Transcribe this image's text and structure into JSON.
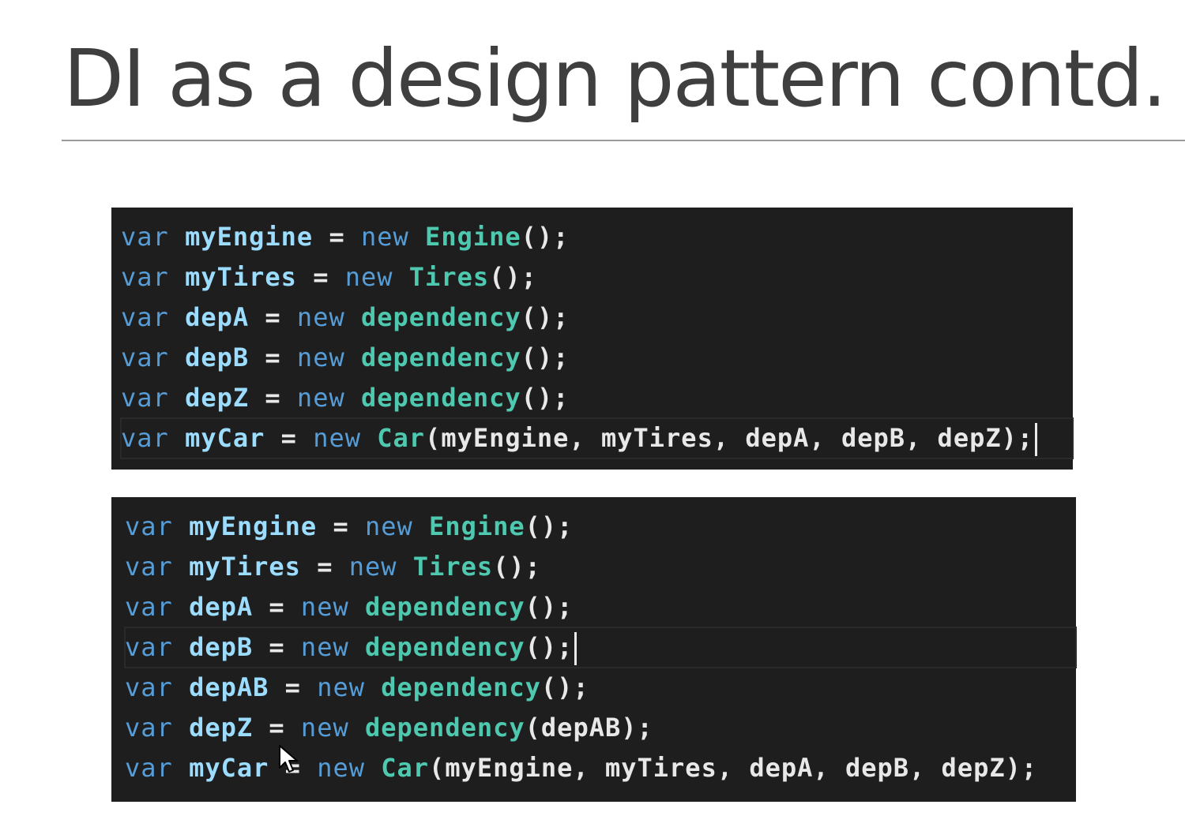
{
  "slide": {
    "title": "DI as a design pattern contd."
  },
  "colors": {
    "editor_background": "#1e1e1e",
    "keyword": "#569cd6",
    "identifier": "#9cdcfe",
    "type_name": "#4ec9b0",
    "punctuation": "#e8e8e8",
    "title_text": "#3f3f3f"
  },
  "code_blocks": [
    {
      "lines": [
        {
          "kw": "var",
          "id": "myEngine",
          "eq": " = ",
          "new": "new",
          "type": "Engine",
          "rest": "();"
        },
        {
          "kw": "var",
          "id": "myTires",
          "eq": " = ",
          "new": "new",
          "type": "Tires",
          "rest": "();"
        },
        {
          "kw": "var",
          "id": "depA",
          "eq": " = ",
          "new": "new",
          "type": "dependency",
          "rest": "();"
        },
        {
          "kw": "var",
          "id": "depB",
          "eq": " = ",
          "new": "new",
          "type": "dependency",
          "rest": "();"
        },
        {
          "kw": "var",
          "id": "depZ",
          "eq": " = ",
          "new": "new",
          "type": "dependency",
          "rest": "();"
        },
        {
          "kw": "var",
          "id": "myCar",
          "eq": " = ",
          "new": "new",
          "type": "Car",
          "rest": "(myEngine, myTires, depA, depB, depZ);"
        }
      ]
    },
    {
      "lines": [
        {
          "kw": "var",
          "id": "myEngine",
          "eq": " = ",
          "new": "new",
          "type": "Engine",
          "rest": "();"
        },
        {
          "kw": "var",
          "id": "myTires",
          "eq": " = ",
          "new": "new",
          "type": "Tires",
          "rest": "();"
        },
        {
          "kw": "var",
          "id": "depA",
          "eq": " = ",
          "new": "new",
          "type": "dependency",
          "rest": "();"
        },
        {
          "kw": "var",
          "id": "depB",
          "eq": " = ",
          "new": "new",
          "type": "dependency",
          "rest": "();"
        },
        {
          "kw": "var",
          "id": "depAB",
          "eq": " = ",
          "new": "new",
          "type": "dependency",
          "rest": "();"
        },
        {
          "kw": "var",
          "id": "depZ",
          "eq": " = ",
          "new": "new",
          "type": "dependency",
          "rest": "(depAB);"
        },
        {
          "kw": "var",
          "id": "myCar",
          "eq": " = ",
          "new": "new",
          "type": "Car",
          "rest": "(myEngine, myTires, depA, depB, depZ);"
        }
      ]
    }
  ]
}
